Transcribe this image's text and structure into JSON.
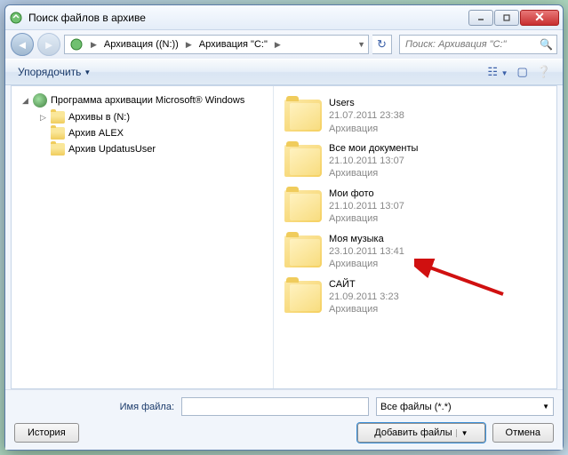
{
  "title": "Поиск файлов в архиве",
  "breadcrumb": {
    "item1": "Архивация ((N:))",
    "item2": "Архивация \"C:\""
  },
  "search": {
    "placeholder": "Поиск: Архивация \"C:\""
  },
  "toolbar": {
    "organize": "Упорядочить"
  },
  "tree": {
    "root": "Программа архивации Microsoft® Windows",
    "items": [
      "Архивы в (N:)",
      "Архив ALEX",
      "Архив UpdatusUser"
    ]
  },
  "files": [
    {
      "name": "Users",
      "date": "21.07.2011 23:38",
      "type": "Архивация"
    },
    {
      "name": "Все мои документы",
      "date": "21.10.2011 13:07",
      "type": "Архивация"
    },
    {
      "name": "Мои фото",
      "date": "21.10.2011 13:07",
      "type": "Архивация"
    },
    {
      "name": "Моя музыка",
      "date": "23.10.2011 13:41",
      "type": "Архивация"
    },
    {
      "name": "САЙТ",
      "date": "21.09.2011 3:23",
      "type": "Архивация"
    }
  ],
  "bottom": {
    "filename_label": "Имя файла:",
    "filter": "Все файлы (*.*)",
    "history": "История",
    "add": "Добавить файлы",
    "cancel": "Отмена"
  }
}
